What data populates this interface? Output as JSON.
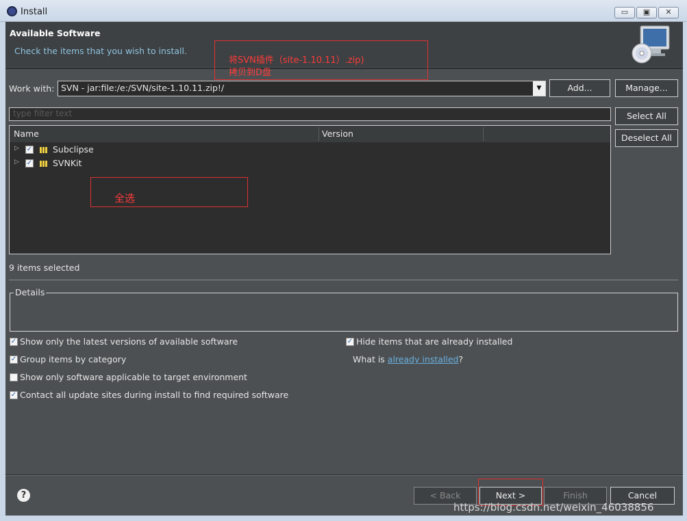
{
  "window": {
    "title": "Install",
    "minimize": "▭",
    "maximize": "▣",
    "close": "✕"
  },
  "header": {
    "title": "Available Software",
    "description": "Check the items that you wish to install.",
    "icon": "monitor-cd-icon"
  },
  "annotations": {
    "copy_plugin_line1": "将SVN插件（site-1.10.11）.zip)",
    "copy_plugin_line2": "拷贝到D盘",
    "select_all": "全选"
  },
  "work_with": {
    "label": "Work with:",
    "value": "SVN - jar:file:/e:/SVN/site-1.10.11.zip!/",
    "add_label": "Add...",
    "manage_label": "Manage..."
  },
  "filter": {
    "placeholder": "type filter text"
  },
  "tree": {
    "columns": [
      "Name",
      "Version"
    ],
    "items": [
      {
        "name": "Subclipse",
        "checked": true
      },
      {
        "name": "SVNKit",
        "checked": true
      }
    ]
  },
  "side_buttons": {
    "select_all": "Select All",
    "deselect_all": "Deselect All"
  },
  "status": "9 items selected",
  "details": {
    "label": "Details"
  },
  "options": {
    "latest_versions": {
      "label": "Show only the latest versions of available software",
      "checked": true
    },
    "group_by_category": {
      "label": "Group items by category",
      "checked": true
    },
    "applicable_only": {
      "label": "Show only software applicable to target environment",
      "checked": false
    },
    "contact_sites": {
      "label": "Contact all update sites during install to find required software",
      "checked": true
    },
    "hide_installed": {
      "label": "Hide items that are already installed",
      "checked": true
    },
    "what_is_prefix": "What is ",
    "what_is_link": "already installed",
    "what_is_suffix": "?"
  },
  "footer": {
    "help": "?",
    "back": "< Back",
    "next": "Next >",
    "finish": "Finish",
    "cancel": "Cancel"
  },
  "watermark": "https://blog.csdn.net/weixin_46038856",
  "colors": {
    "background": "#4c5052",
    "tree_bg": "#2d2d2d",
    "link": "#6ab0e0",
    "annotation": "#e03030"
  }
}
